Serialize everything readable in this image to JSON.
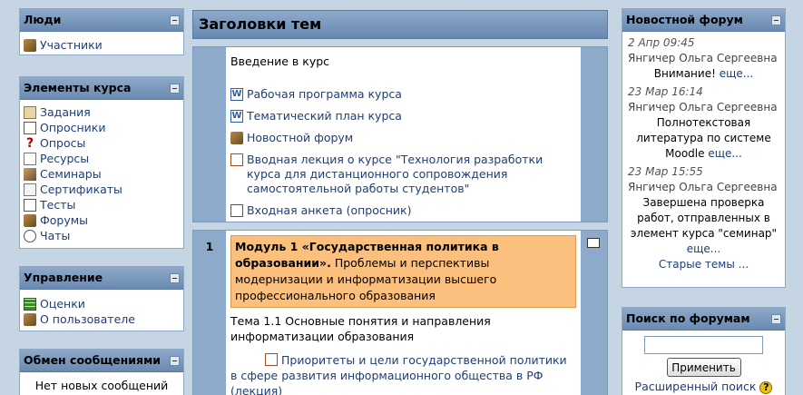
{
  "left": {
    "people": {
      "title": "Люди",
      "items": [
        {
          "label": "Участники",
          "icon": "users-icon"
        }
      ]
    },
    "elements": {
      "title": "Элементы курса",
      "items": [
        {
          "label": "Задания",
          "icon": "assignment-icon"
        },
        {
          "label": "Опросники",
          "icon": "questionnaire-icon"
        },
        {
          "label": "Опросы",
          "icon": "choice-icon"
        },
        {
          "label": "Ресурсы",
          "icon": "resource-icon"
        },
        {
          "label": "Семинары",
          "icon": "workshop-icon"
        },
        {
          "label": "Сертификаты",
          "icon": "certificate-icon"
        },
        {
          "label": "Тесты",
          "icon": "quiz-icon"
        },
        {
          "label": "Форумы",
          "icon": "forum-icon"
        },
        {
          "label": "Чаты",
          "icon": "chat-icon"
        }
      ]
    },
    "admin": {
      "title": "Управление",
      "items": [
        {
          "label": "Оценки",
          "icon": "grades-icon"
        },
        {
          "label": "О пользователе",
          "icon": "profile-icon"
        }
      ]
    },
    "messages": {
      "title": "Обмен сообщениями",
      "text": "Нет новых сообщений"
    }
  },
  "center": {
    "title": "Заголовки тем",
    "section0": {
      "summary": "Введение в курс",
      "items": [
        {
          "label": "Рабочая программа курса",
          "icon": "word-doc-icon"
        },
        {
          "label": "Тематический план курса",
          "icon": "word-doc-icon"
        },
        {
          "label": "Новостной форум",
          "icon": "forum-icon"
        },
        {
          "label": "Вводная лекция о курсе \"Технология разработки курса для дистанционного сопровождения самостоятельной работы студентов\"",
          "icon": "document-icon"
        },
        {
          "label": "Входная анкета (опросник)",
          "icon": "questionnaire-icon"
        }
      ]
    },
    "section1": {
      "number": "1",
      "summary_bold": "Модуль 1 «Государственная политика в образовании».",
      "summary_rest": " Проблемы и перспективы модернизации и информатизации высшего профессионального образования",
      "topic": "Тема 1.1 Основные понятия и направления информатизации образования",
      "item": "Приоритеты и цели государственной политики в сфере развития информационного общества в РФ (лекция)"
    }
  },
  "right": {
    "news": {
      "title": "Новостной форум",
      "entries": [
        {
          "date": "2 Апр 09:45",
          "author": "Янгичер Ольга Сергеевна",
          "text": "Внимание!",
          "more": "еще..."
        },
        {
          "date": "23 Мар 16:14",
          "author": "Янгичер Ольга Сергеевна",
          "text": "Полнотекстовая литература по системе Moodle",
          "more": "еще..."
        },
        {
          "date": "23 Мар 15:55",
          "author": "Янгичер Ольга Сергеевна",
          "text": "Завершена проверка работ, отправленных в элемент курса \"семинар\"",
          "more": "еще..."
        }
      ],
      "older": "Старые темы ..."
    },
    "search": {
      "title": "Поиск по форумам",
      "button": "Применить",
      "advanced": "Расширенный поиск"
    }
  }
}
